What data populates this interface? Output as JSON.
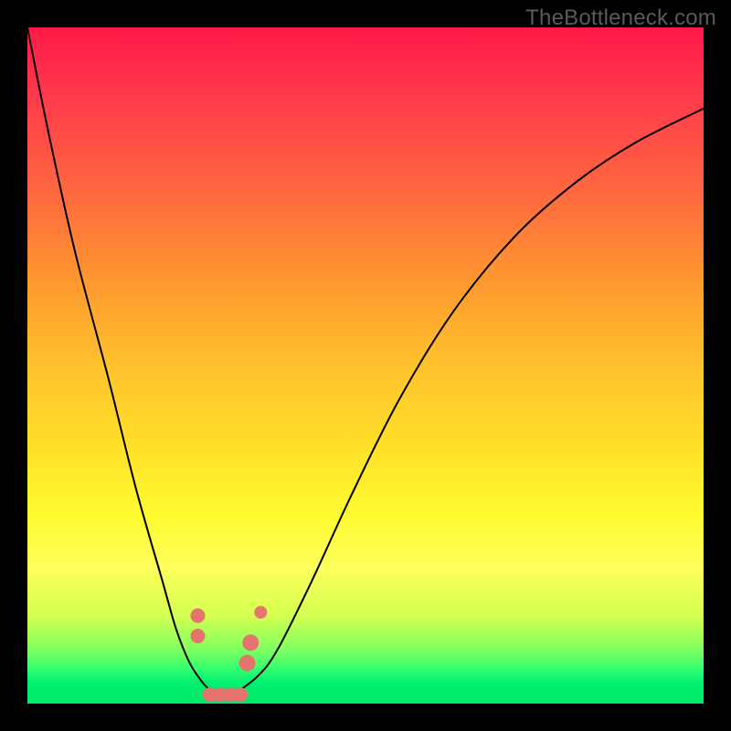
{
  "watermark": "TheBottleneck.com",
  "background": {
    "frame_color": "#000000",
    "gradient_top": "#ff1a48",
    "gradient_bottom": "#00e868"
  },
  "chart_data": {
    "type": "line",
    "title": "",
    "xlabel": "",
    "ylabel": "",
    "xlim": [
      0,
      100
    ],
    "ylim": [
      0,
      100
    ],
    "grid": false,
    "series": [
      {
        "name": "left-curve",
        "x": [
          0,
          3,
          7,
          12,
          16,
          20,
          22,
          24,
          26,
          27,
          28,
          29,
          30
        ],
        "y": [
          100,
          85,
          67,
          48,
          32,
          18,
          11,
          6,
          3,
          2,
          1,
          1,
          1
        ]
      },
      {
        "name": "right-curve",
        "x": [
          30,
          34,
          37,
          42,
          48,
          55,
          63,
          72,
          81,
          90,
          100
        ],
        "y": [
          1,
          4,
          8,
          18,
          31,
          45,
          58,
          69,
          77,
          83,
          88
        ]
      }
    ],
    "markers": [
      {
        "x": 25.2,
        "y": 13,
        "r": 8
      },
      {
        "x": 25.2,
        "y": 10,
        "r": 8
      },
      {
        "x": 27,
        "y": 1.3,
        "r": 8
      },
      {
        "x": 28.5,
        "y": 1.3,
        "r": 8
      },
      {
        "x": 30,
        "y": 1.3,
        "r": 8
      },
      {
        "x": 31.5,
        "y": 1.3,
        "r": 8
      },
      {
        "x": 32.5,
        "y": 6,
        "r": 9
      },
      {
        "x": 33,
        "y": 9,
        "r": 9
      },
      {
        "x": 34.5,
        "y": 13.5,
        "r": 7
      }
    ]
  }
}
